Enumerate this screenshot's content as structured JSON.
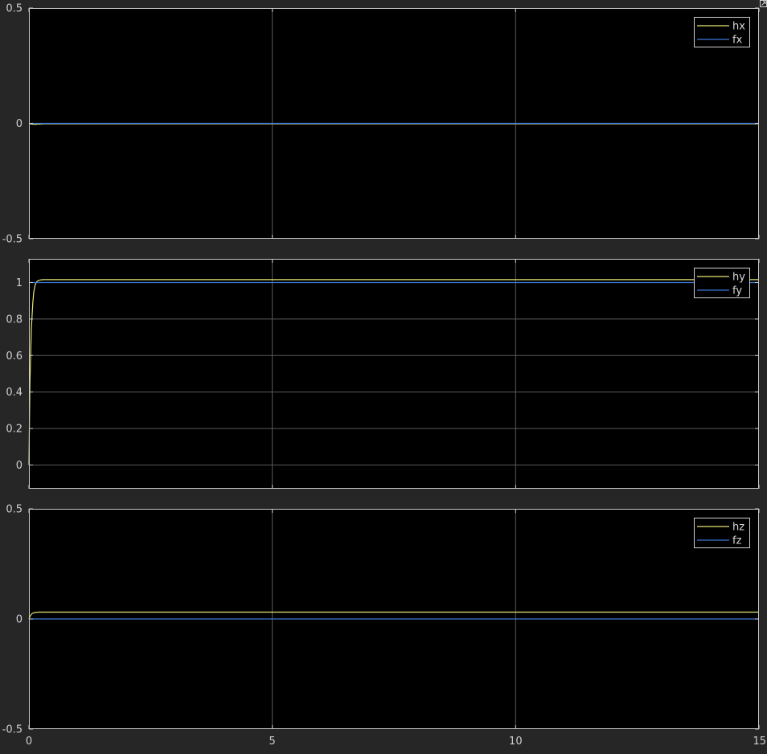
{
  "colors": {
    "figure_bg": "#262626",
    "axes_bg": "#000000",
    "axes_border": "#c8c8c8",
    "grid": "#5a5a5a",
    "tick_text": "#cfcfcf",
    "legend_bg": "#000000",
    "legend_border": "#cfcfcf",
    "legend_text": "#d8d8d8",
    "series_h": "#e6e676",
    "series_f": "#3c78dc"
  },
  "icons": {
    "corner": "expand-icon"
  },
  "chart_data": [
    {
      "type": "line",
      "xlim": [
        0,
        15
      ],
      "ylim": [
        -0.5,
        0.5
      ],
      "xticks": [
        0,
        5,
        10,
        15
      ],
      "yticks": [
        -0.5,
        0,
        0.5
      ],
      "ytick_labels": [
        "-0.5",
        "0",
        "0.5"
      ],
      "show_xtick_labels": false,
      "grid": true,
      "legend": "top-right",
      "series": [
        {
          "name": "hx",
          "color_key": "series_h",
          "x": [
            0,
            0.05,
            0.1,
            0.2,
            0.3,
            15
          ],
          "y": [
            0,
            -0.003,
            -0.004,
            -0.003,
            -0.002,
            -0.002
          ]
        },
        {
          "name": "fx",
          "color_key": "series_f",
          "x": [
            0,
            15
          ],
          "y": [
            0,
            0
          ]
        }
      ]
    },
    {
      "type": "line",
      "xlim": [
        0,
        15
      ],
      "ylim": [
        -0.13,
        1.13
      ],
      "xticks": [
        0,
        5,
        10,
        15
      ],
      "yticks": [
        0,
        0.2,
        0.4,
        0.6,
        0.8,
        1
      ],
      "ytick_labels": [
        "0",
        "0.2",
        "0.4",
        "0.6",
        "0.8",
        "1"
      ],
      "show_xtick_labels": false,
      "grid": true,
      "legend": "top-right",
      "series": [
        {
          "name": "hy",
          "color_key": "series_h",
          "x": [
            0,
            0.02,
            0.05,
            0.08,
            0.1,
            0.13,
            0.16,
            0.2,
            0.25,
            0.3,
            0.4,
            15
          ],
          "y": [
            0,
            0.45,
            0.75,
            0.89,
            0.95,
            0.99,
            1.005,
            1.012,
            1.015,
            1.016,
            1.016,
            1.016
          ]
        },
        {
          "name": "fy",
          "color_key": "series_f",
          "x": [
            0,
            15
          ],
          "y": [
            1,
            1
          ]
        }
      ]
    },
    {
      "type": "line",
      "xlim": [
        0,
        15
      ],
      "ylim": [
        -0.5,
        0.5
      ],
      "xticks": [
        0,
        5,
        10,
        15
      ],
      "yticks": [
        -0.5,
        0,
        0.5
      ],
      "ytick_labels": [
        "-0.5",
        "0",
        "0.5"
      ],
      "xtick_labels": [
        "0",
        "5",
        "10",
        "15"
      ],
      "show_xtick_labels": true,
      "grid": true,
      "legend": "top-right",
      "series": [
        {
          "name": "hz",
          "color_key": "series_h",
          "x": [
            0,
            0.03,
            0.06,
            0.1,
            0.15,
            0.2,
            0.3,
            15
          ],
          "y": [
            0,
            0.015,
            0.024,
            0.028,
            0.03,
            0.031,
            0.031,
            0.031
          ]
        },
        {
          "name": "fz",
          "color_key": "series_f",
          "x": [
            0,
            15
          ],
          "y": [
            0,
            0
          ]
        }
      ]
    }
  ]
}
